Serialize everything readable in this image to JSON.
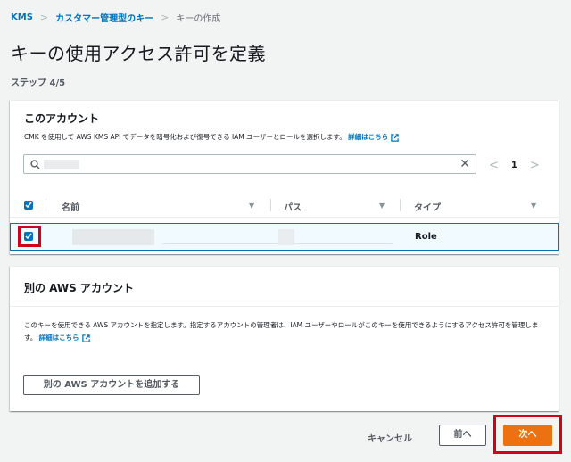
{
  "breadcrumb": {
    "root": "KMS",
    "parent": "カスタマー管理型のキー",
    "current": "キーの作成"
  },
  "page": {
    "title": "キーの使用アクセス許可を定義",
    "step": "ステップ 4/5"
  },
  "this_account": {
    "heading": "このアカウント",
    "description": "CMK を使用して AWS KMS API でデータを暗号化および復号できる IAM ユーザーとロールを選択します。",
    "learn_more": "詳細はこちら",
    "search": {
      "value": "",
      "placeholder": ""
    },
    "pagination": {
      "page": "1"
    },
    "table": {
      "columns": [
        "名前",
        "パス",
        "タイプ"
      ],
      "rows": [
        {
          "name": "",
          "path": "",
          "type": "Role",
          "checked": true
        }
      ]
    }
  },
  "other_account": {
    "heading": "別の AWS アカウント",
    "description": "このキーを使用できる AWS アカウントを指定します。指定するアカウントの管理者は、IAM ユーザーやロールがこのキーを使用できるようにするアクセス許可を管理します。",
    "learn_more": "詳細はこちら",
    "add_button": "別の AWS アカウントを追加する"
  },
  "footer": {
    "cancel": "キャンセル",
    "previous": "前へ",
    "next": "次へ"
  },
  "colors": {
    "link": "#0073bb",
    "primary": "#ec7211",
    "highlight": "#d0021b"
  }
}
